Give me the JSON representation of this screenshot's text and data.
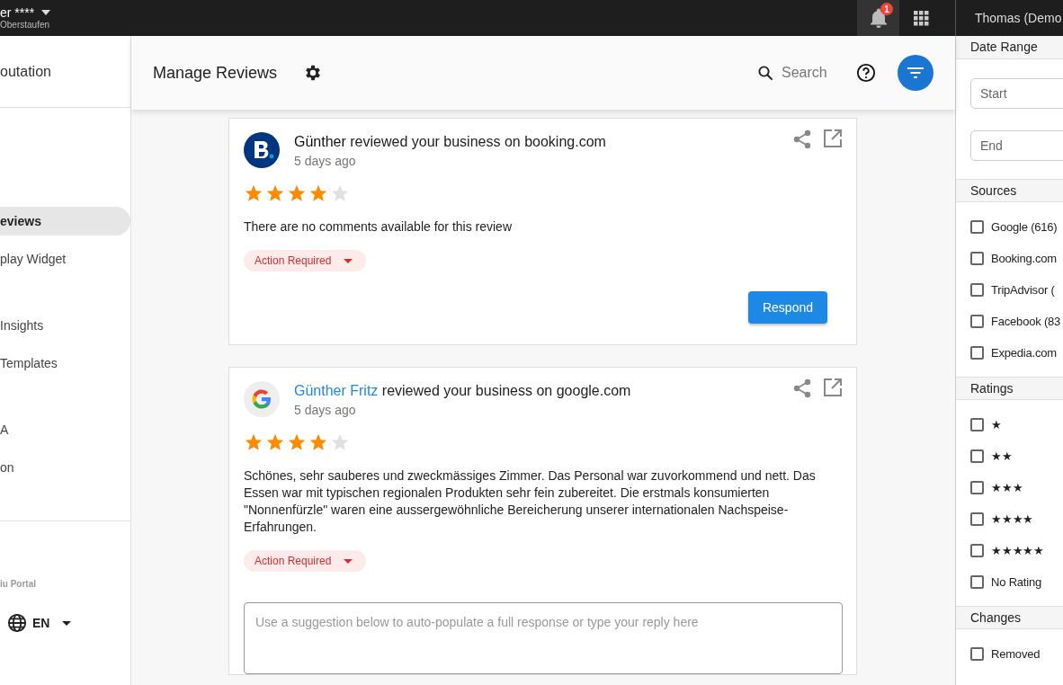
{
  "top_bar": {
    "business_name": "er ****",
    "location": "Oberstaufen",
    "notification_count": "1",
    "user": "Thomas (Demo"
  },
  "sidebar": {
    "header": "outation",
    "groups": [
      [
        {
          "label": "eviews",
          "selected": true
        },
        {
          "label": "play Widget",
          "selected": false
        }
      ],
      [
        {
          "label": "Insights",
          "selected": false
        },
        {
          "label": "Templates",
          "selected": false
        }
      ],
      [
        {
          "label": "A",
          "selected": false
        },
        {
          "label": "on",
          "selected": false
        }
      ]
    ],
    "footer": "iu Portal",
    "language": "EN"
  },
  "header": {
    "title": "Manage Reviews",
    "search_placeholder": "Search"
  },
  "reviews": [
    {
      "kind": "booking",
      "reviewer": "Günther",
      "linked": false,
      "action": "reviewed your business on booking.com",
      "time": "5 days ago",
      "stars": 4,
      "comment": "There are no comments available for this review",
      "status": "Action Required",
      "response": {
        "kind": "button",
        "label": "Respond"
      }
    },
    {
      "kind": "google",
      "reviewer": "Günther Fritz",
      "linked": true,
      "action": "reviewed your business on google.com",
      "time": "5 days ago",
      "stars": 4,
      "comment": "Schönes, sehr sauberes und zweckmässiges Zimmer. Das Personal war zuvorkommend und nett. Das Essen war mit typischen regionalen Produkten sehr fein zubereitet. Die erstmals konsumierten \"Nonnenfürzle\" waren eine aussergewöhnliche Bereicherung unserer internationalen Nachspeise-Erfahrungen.",
      "status": "Action Required",
      "response": {
        "kind": "reply_box",
        "placeholder": "Use a suggestion below to auto-populate a full response or type your reply here"
      }
    }
  ],
  "filters": [
    {
      "title": "Date Range",
      "kind": "dates",
      "fields": [
        {
          "placeholder": "Start"
        },
        {
          "placeholder": "End"
        }
      ]
    },
    {
      "title": "Sources",
      "kind": "checkboxes",
      "options": [
        {
          "label": "Google (616)",
          "checked": false
        },
        {
          "label": "Booking.com",
          "checked": false
        },
        {
          "label": "TripAdvisor (",
          "checked": false
        },
        {
          "label": "Facebook (83",
          "checked": false
        },
        {
          "label": "Expedia.com",
          "checked": false
        }
      ]
    },
    {
      "title": "Ratings",
      "kind": "checkboxes",
      "options": [
        {
          "label": "★",
          "checked": false
        },
        {
          "label": "★★",
          "checked": false
        },
        {
          "label": "★★★",
          "checked": false
        },
        {
          "label": "★★★★",
          "checked": false
        },
        {
          "label": "★★★★★",
          "checked": false
        },
        {
          "label": "No Rating",
          "checked": false
        }
      ]
    },
    {
      "title": "Changes",
      "kind": "checkboxes",
      "options": [
        {
          "label": "Removed",
          "checked": false
        }
      ]
    }
  ]
}
